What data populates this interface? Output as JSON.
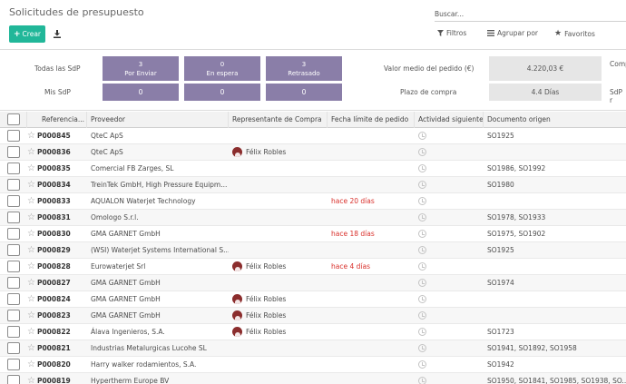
{
  "header": {
    "title": "Solicitudes de presupuesto",
    "create_label": "Crear",
    "search_placeholder": "Buscar...",
    "filters_label": "Filtros",
    "group_by_label": "Agrupar por",
    "favorites_label": "Favoritos"
  },
  "dashboard": {
    "all_rfq_label": "Todas las SdP",
    "my_rfq_label": "Mis SdP",
    "tiles": [
      {
        "count": "3",
        "label": "Por Enviar",
        "my": "0"
      },
      {
        "count": "0",
        "label": "En espera",
        "my": "0"
      },
      {
        "count": "3",
        "label": "Retrasado",
        "my": "0"
      }
    ],
    "avg_order_label": "Valor medio del pedido (€)",
    "avg_order_value": "4.220,03 €",
    "lead_time_label": "Plazo de compra",
    "lead_time_value": "4.4  Días",
    "right_label_1": "Comp",
    "right_label_2": "SdP r"
  },
  "table": {
    "columns": [
      "Referencia...",
      "Proveedor",
      "Representante de Compra",
      "Fecha límite de pedido",
      "Actividad siguiente",
      "Documento origen"
    ],
    "rows": [
      {
        "ref": "P000845",
        "vendor": "QteC ApS",
        "rep": "",
        "deadline": "",
        "origin": "SO1925"
      },
      {
        "ref": "P000836",
        "vendor": "QteC ApS",
        "rep": "Félix Robles",
        "deadline": "",
        "origin": ""
      },
      {
        "ref": "P000835",
        "vendor": "Comercial FB Zarges, SL",
        "rep": "",
        "deadline": "",
        "origin": "SO1986, SO1992"
      },
      {
        "ref": "P000834",
        "vendor": "TreinTek GmbH, High Pressure Equipm...",
        "rep": "",
        "deadline": "",
        "origin": "SO1980"
      },
      {
        "ref": "P000833",
        "vendor": "AQUALON Waterjet Technology",
        "rep": "",
        "deadline": "hace 20 días",
        "origin": ""
      },
      {
        "ref": "P000831",
        "vendor": "Omologo S.r.l.",
        "rep": "",
        "deadline": "",
        "origin": "SO1978, SO1933"
      },
      {
        "ref": "P000830",
        "vendor": "GMA GARNET GmbH",
        "rep": "",
        "deadline": "hace 18 días",
        "origin": "SO1975, SO1902"
      },
      {
        "ref": "P000829",
        "vendor": "(WSI) Waterjet Systems International S...",
        "rep": "",
        "deadline": "",
        "origin": "SO1925"
      },
      {
        "ref": "P000828",
        "vendor": "Eurowaterjet Srl",
        "rep": "Félix Robles",
        "deadline": "hace 4 días",
        "origin": ""
      },
      {
        "ref": "P000827",
        "vendor": "GMA GARNET GmbH",
        "rep": "",
        "deadline": "",
        "origin": "SO1974"
      },
      {
        "ref": "P000824",
        "vendor": "GMA GARNET GmbH",
        "rep": "Félix Robles",
        "deadline": "",
        "origin": ""
      },
      {
        "ref": "P000823",
        "vendor": "GMA GARNET GmbH",
        "rep": "Félix Robles",
        "deadline": "",
        "origin": ""
      },
      {
        "ref": "P000822",
        "vendor": "Álava Ingenieros, S.A.",
        "rep": "Félix Robles",
        "deadline": "",
        "origin": "SO1723"
      },
      {
        "ref": "P000821",
        "vendor": "Industrias Metalurgicas Lucohe SL",
        "rep": "",
        "deadline": "",
        "origin": "SO1941, SO1892, SO1958"
      },
      {
        "ref": "P000820",
        "vendor": "Harry walker rodamientos, S.A.",
        "rep": "",
        "deadline": "",
        "origin": "SO1942"
      },
      {
        "ref": "P000819",
        "vendor": "Hypertherm Europe BV",
        "rep": "",
        "deadline": "",
        "origin": "SO1950, SO1841, SO1985, SO1938, SO..."
      }
    ]
  },
  "colors": {
    "primary": "#21b799",
    "tile": "#8a7ea8",
    "late": "#d9302b"
  }
}
